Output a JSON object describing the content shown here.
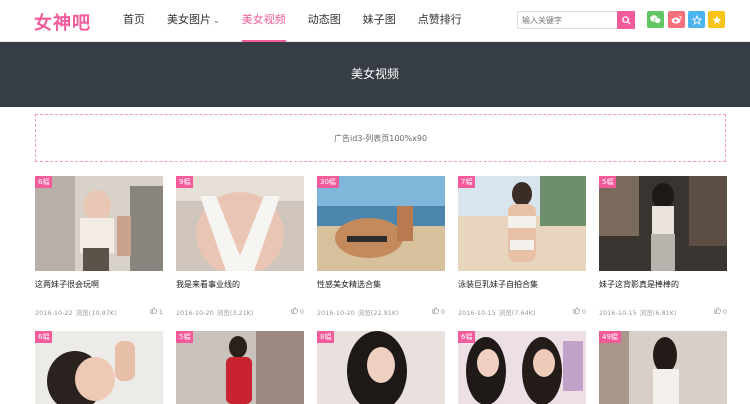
{
  "header": {
    "logo": "女神吧",
    "nav": [
      {
        "label": "首页"
      },
      {
        "label": "美女图片",
        "caret": "⌄"
      },
      {
        "label": "美女视频"
      },
      {
        "label": "动态图"
      },
      {
        "label": "妹子图"
      },
      {
        "label": "点赞排行"
      }
    ],
    "active_nav": "美女视频",
    "search_placeholder": "输入关键字",
    "social": [
      "wechat-icon",
      "weibo-icon",
      "qzone-icon",
      "star-icon"
    ]
  },
  "banner": {
    "title": "美女视频"
  },
  "ad": {
    "text": "广告id3-列表页100%x90"
  },
  "cards": [
    {
      "badge": "6幅",
      "title": "这两妹子很会玩啊",
      "date": "2016-10-22",
      "views": "浏览(10.97K)",
      "likes": "1"
    },
    {
      "badge": "9幅",
      "title": "我是来看事业线的",
      "date": "2016-10-20",
      "views": "浏览(3.21K)",
      "likes": "0"
    },
    {
      "badge": "30幅",
      "title": "性感美女精选合集",
      "date": "2016-10-20",
      "views": "浏览(22.91K)",
      "likes": "0"
    },
    {
      "badge": "7幅",
      "title": "泳装巨乳妹子自拍合集",
      "date": "2016-10-15",
      "views": "浏览(7.64K)",
      "likes": "0"
    },
    {
      "badge": "5幅",
      "title": "妹子这背影真是棒棒的",
      "date": "2016-10-15",
      "views": "浏览(6.81K)",
      "likes": "0"
    },
    {
      "badge": "6幅"
    },
    {
      "badge": "5幅"
    },
    {
      "badge": "8幅"
    },
    {
      "badge": "6幅"
    },
    {
      "badge": "49幅"
    }
  ]
}
